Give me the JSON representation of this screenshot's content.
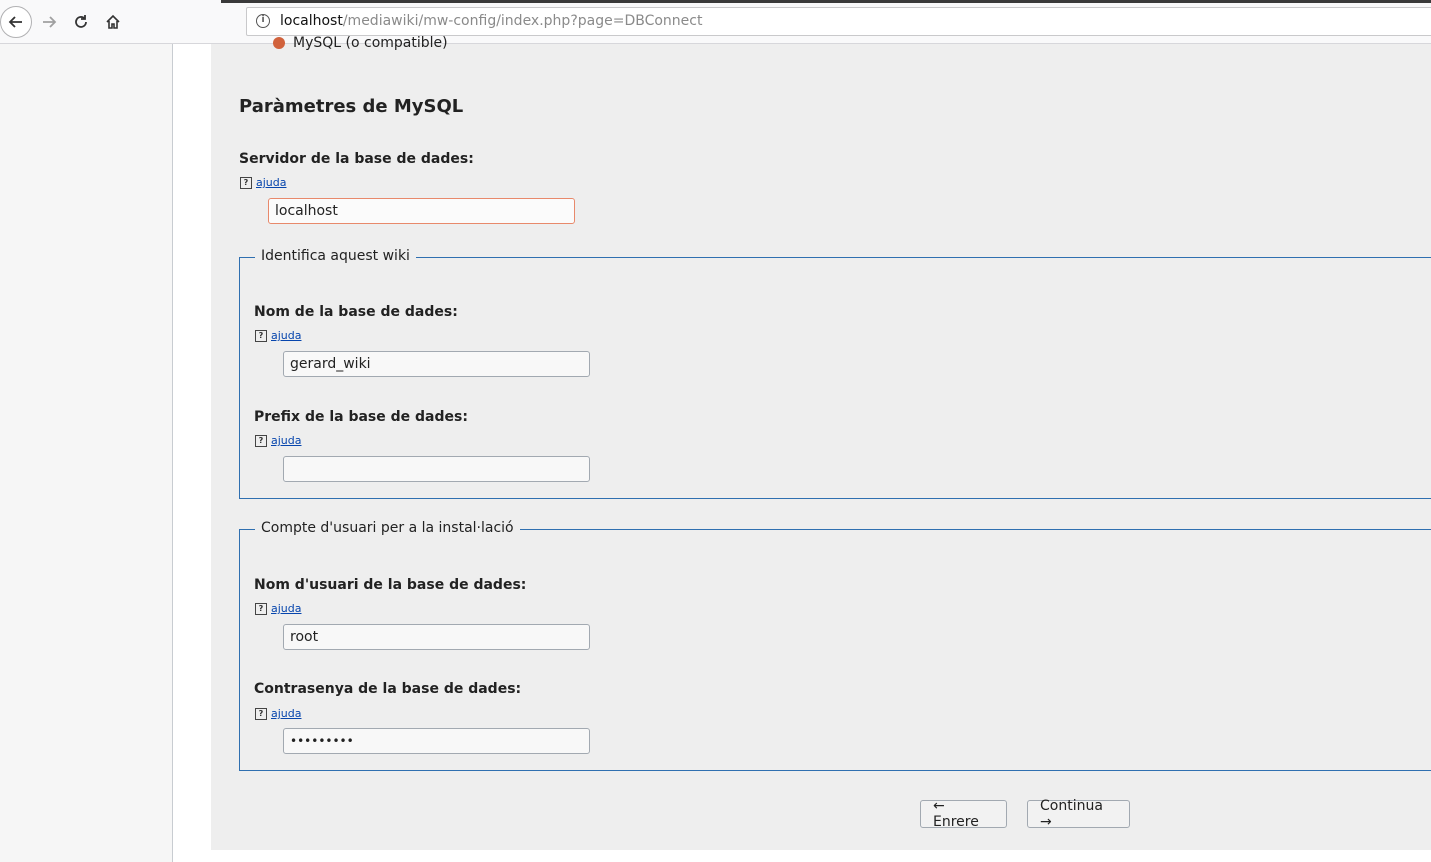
{
  "browser": {
    "url_host": "localhost",
    "url_path": "/mediawiki/mw-config/index.php?page=DBConnect"
  },
  "db_type": {
    "selected_label": "MySQL (o compatible)"
  },
  "section": {
    "title": "Paràmetres de MySQL"
  },
  "help_label": "ajuda",
  "server": {
    "label": "Servidor de la base de dades:",
    "value": "localhost"
  },
  "identify": {
    "legend": "Identifica aquest wiki",
    "dbname_label": "Nom de la base de dades:",
    "dbname_value": "gerard_wiki",
    "prefix_label": "Prefix de la base de dades:",
    "prefix_value": ""
  },
  "install_account": {
    "legend": "Compte d'usuari per a la instal·lació",
    "user_label": "Nom d'usuari de la base de dades:",
    "user_value": "root",
    "password_label": "Contrasenya de la base de dades:",
    "password_value": "•••••••••"
  },
  "buttons": {
    "back": "← Enrere",
    "continue": "Continua →"
  },
  "colors": {
    "fieldset_border": "#2f6fb0",
    "focus_border": "#e8896b",
    "link": "#0645ad"
  }
}
